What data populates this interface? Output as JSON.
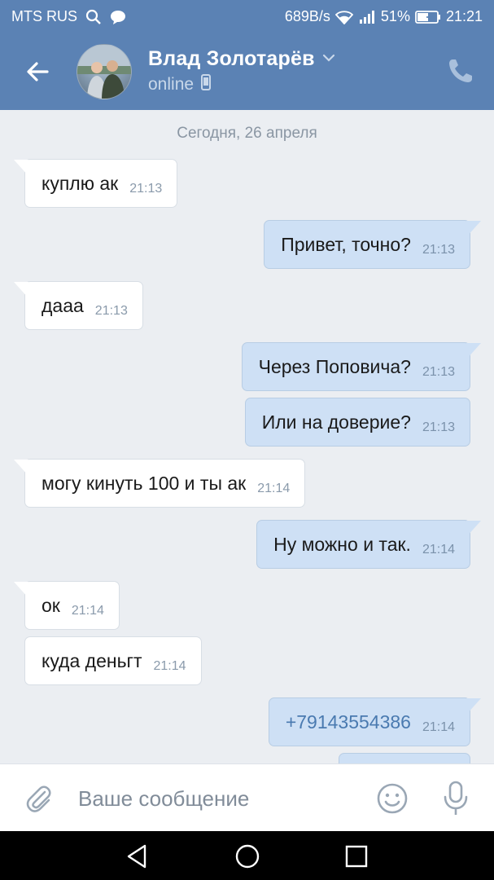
{
  "status_bar": {
    "carrier": "MTS RUS",
    "speed": "689B/s",
    "battery_percent": "51%",
    "time": "21:21"
  },
  "header": {
    "contact_name": "Влад Золотарёв",
    "presence": "online",
    "icons": [
      "back-arrow-icon",
      "chevron-down-icon",
      "mobile-icon",
      "phone-icon"
    ]
  },
  "chat": {
    "date_separator": "Сегодня, 26 апреля",
    "messages": [
      {
        "direction": "in",
        "text": "куплю ак",
        "time": "21:13"
      },
      {
        "direction": "out",
        "text": "Привет, точно?",
        "time": "21:13"
      },
      {
        "direction": "in",
        "text": "дааа",
        "time": "21:13"
      },
      {
        "direction": "out",
        "text": "Через Поповича?",
        "time": "21:13"
      },
      {
        "direction": "out",
        "text": "Или на доверие?",
        "time": "21:13"
      },
      {
        "direction": "in",
        "text": "могу кинуть 100 и ты ак",
        "time": "21:14"
      },
      {
        "direction": "out",
        "text": "Ну можно и так.",
        "time": "21:14"
      },
      {
        "direction": "in",
        "text": "ок",
        "time": "21:14"
      },
      {
        "direction": "in",
        "text": "куда деньгт",
        "time": "21:14"
      },
      {
        "direction": "out",
        "text": "+79143554386",
        "time": "21:14",
        "is_link": true
      }
    ]
  },
  "input": {
    "placeholder": "Ваше сообщение",
    "value": ""
  },
  "colors": {
    "header_bg": "#5b82b4",
    "chat_bg": "#ebeef2",
    "incoming_bubble": "#ffffff",
    "outgoing_bubble": "#cee0f5",
    "link": "#4a7ab0"
  }
}
